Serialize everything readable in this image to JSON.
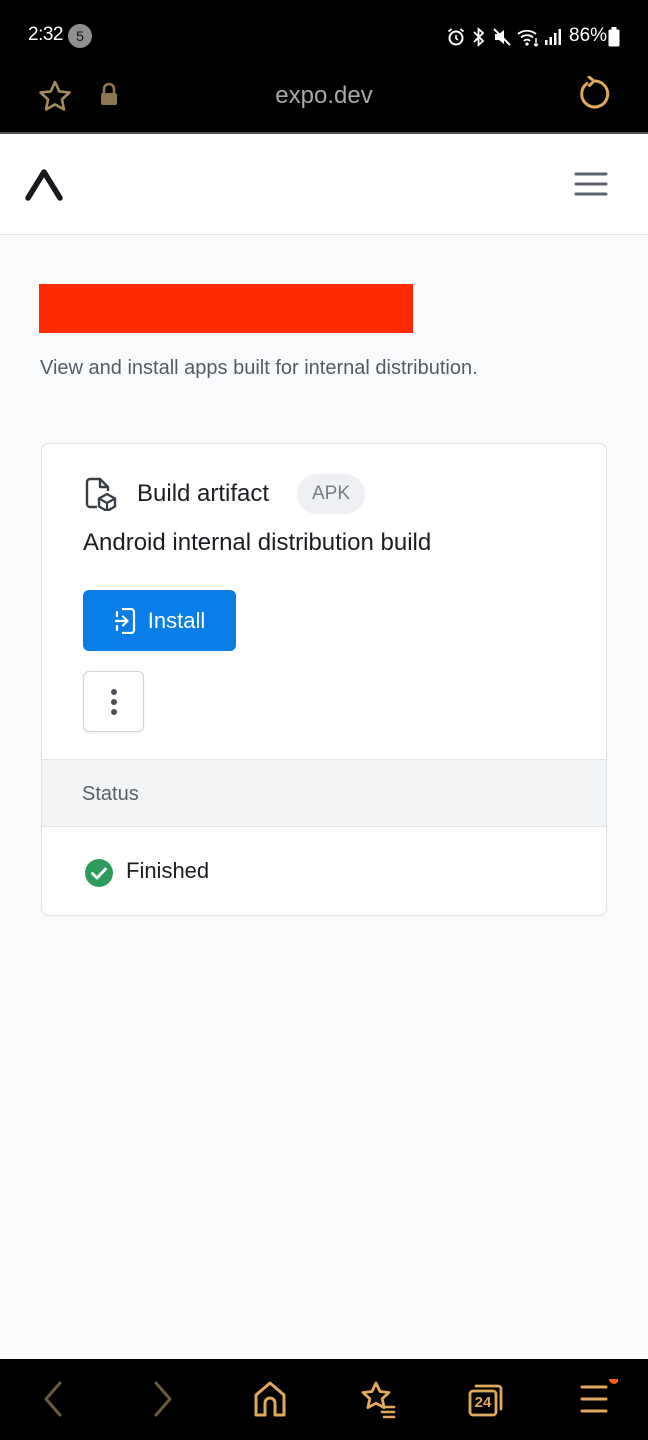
{
  "status_bar": {
    "time": "2:32",
    "notification_count": "5",
    "battery": "86%",
    "icons": [
      "alarm-icon",
      "bluetooth-icon",
      "mute-icon",
      "wifi-icon",
      "signal-icon",
      "battery-icon"
    ]
  },
  "browser": {
    "url": "expo.dev",
    "icons": [
      "star-icon",
      "lock-icon",
      "reload-icon"
    ],
    "accent_color": "#e0a95b"
  },
  "site_header": {
    "icons": [
      "expo-logo",
      "hamburger-menu-icon"
    ]
  },
  "page": {
    "subtitle": "View and install apps built for internal distribution."
  },
  "card": {
    "artifact_label": "Build artifact",
    "artifact_badge": "APK",
    "build_description": "Android internal distribution build",
    "install_label": "Install",
    "status_header": "Status",
    "status_value": "Finished",
    "colors": {
      "install_button": "#0a7ee8",
      "success": "#2e9b5b"
    }
  },
  "bottom_nav": {
    "tab_count": "24",
    "items": [
      "back-icon",
      "forward-icon",
      "home-icon",
      "bookmarks-icon",
      "tabs-icon",
      "menu-icon"
    ]
  }
}
